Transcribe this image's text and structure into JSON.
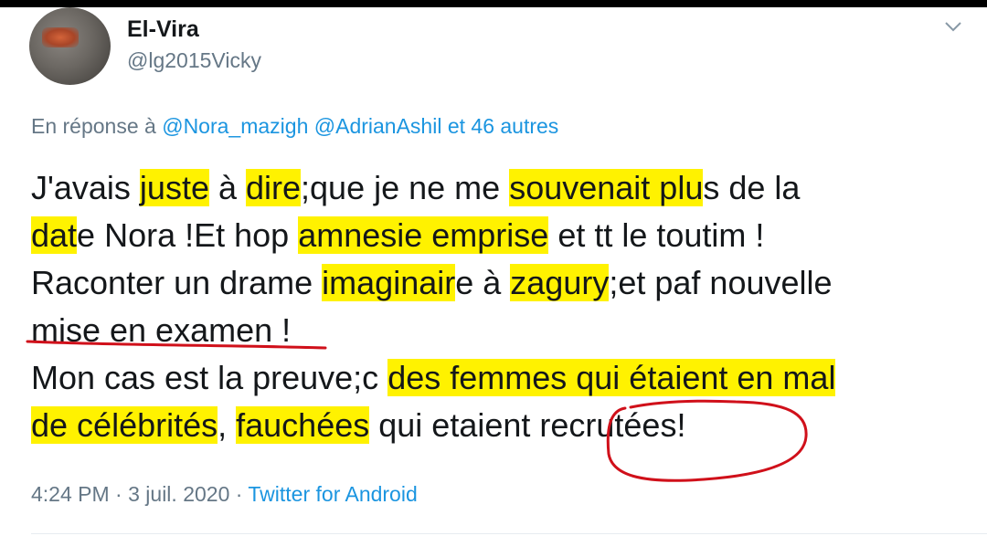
{
  "tweet": {
    "author_name": "El-Vira",
    "author_handle": "@lg2015Vicky",
    "reply_prefix": "En réponse à ",
    "reply_mentions": [
      "@Nora_mazigh",
      "@AdrianAshil"
    ],
    "reply_suffix": " et 46 autres",
    "lines": [
      [
        {
          "t": "J'avais "
        },
        {
          "t": "juste",
          "hl": true
        },
        {
          "t": " à "
        },
        {
          "t": "dire",
          "hl": true
        },
        {
          "t": ";que je ne me "
        },
        {
          "t": "souvenait plu",
          "hl": true
        },
        {
          "t": "s de la"
        }
      ],
      [
        {
          "t": "dat",
          "hl": true
        },
        {
          "t": "e Nora !Et hop "
        },
        {
          "t": "amnesie emprise",
          "hl": true
        },
        {
          "t": " et tt le toutim !"
        }
      ],
      [
        {
          "t": "Raconter un drame "
        },
        {
          "t": "imaginair",
          "hl": true
        },
        {
          "t": "e à "
        },
        {
          "t": "zagury",
          "hl": true
        },
        {
          "t": ";et paf nouvelle"
        }
      ],
      [
        {
          "t": "mise en examen !"
        }
      ],
      [
        {
          "t": "Mon cas est la preuve;c "
        },
        {
          "t": "des femmes qui étaient en mal",
          "hl": true
        }
      ],
      [
        {
          "t": "de célébrités",
          "hl": true
        },
        {
          "t": ", "
        },
        {
          "t": "fauchées",
          "hl": true
        },
        {
          "t": " qui etaient recrutées!"
        }
      ]
    ],
    "time": "4:24 PM",
    "dot": " · ",
    "date": "3 juil. 2020",
    "source": "Twitter for Android",
    "highlight_color": "#fff200",
    "annotation_color": "#d0101a",
    "icons": {
      "menu": "chevron-down-icon",
      "avatar": "avatar-photo"
    }
  }
}
